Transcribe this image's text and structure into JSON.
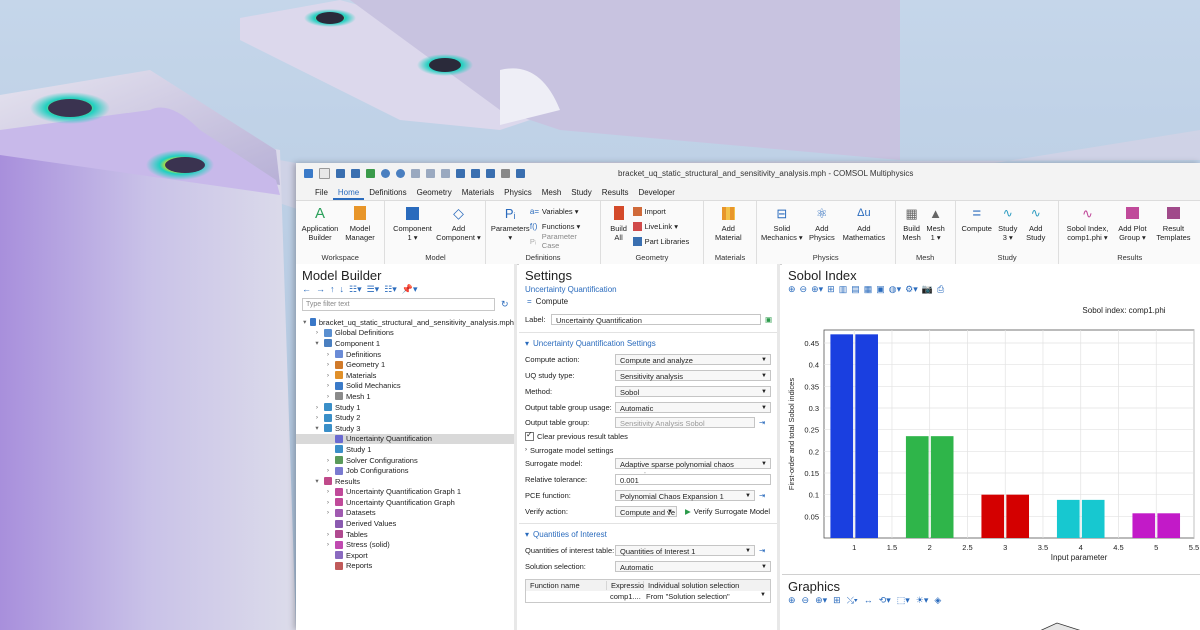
{
  "window": {
    "title": "bracket_uq_static_structural_and_sensitivity_analysis.mph - COMSOL Multiphysics"
  },
  "menu": [
    "File",
    "Home",
    "Definitions",
    "Geometry",
    "Materials",
    "Physics",
    "Mesh",
    "Study",
    "Results",
    "Developer"
  ],
  "active_menu": "Home",
  "ribbon": {
    "workspace": {
      "label": "Workspace",
      "buttons": [
        {
          "l1": "Application",
          "l2": "Builder"
        },
        {
          "l1": "Model",
          "l2": "Manager"
        }
      ]
    },
    "model": {
      "label": "Model",
      "buttons": [
        {
          "l1": "Component",
          "l2": "1 ▾"
        },
        {
          "l1": "Add",
          "l2": "Component ▾"
        }
      ]
    },
    "definitions": {
      "label": "Definitions",
      "parameters": {
        "l1": "Parameters",
        "l2": "▾"
      },
      "small": [
        "Variables ▾",
        "Functions ▾",
        "Parameter Case"
      ]
    },
    "geometry": {
      "label": "Geometry",
      "build": {
        "l1": "Build",
        "l2": "All"
      },
      "small": [
        "Import",
        "LiveLink ▾",
        "Part Libraries"
      ]
    },
    "materials": {
      "label": "Materials",
      "buttons": [
        {
          "l1": "Add",
          "l2": "Material"
        }
      ]
    },
    "physics": {
      "label": "Physics",
      "buttons": [
        {
          "l1": "Solid",
          "l2": "Mechanics ▾"
        },
        {
          "l1": "Add",
          "l2": "Physics"
        },
        {
          "l1": "Add",
          "l2": "Mathematics"
        }
      ]
    },
    "mesh": {
      "label": "Mesh",
      "buttons": [
        {
          "l1": "Build",
          "l2": "Mesh"
        },
        {
          "l1": "Mesh",
          "l2": "1 ▾"
        }
      ]
    },
    "study": {
      "label": "Study",
      "buttons": [
        {
          "l1": "Compute",
          "l2": ""
        },
        {
          "l1": "Study",
          "l2": "3 ▾"
        },
        {
          "l1": "Add",
          "l2": "Study"
        }
      ]
    },
    "results": {
      "label": "Results",
      "buttons": [
        {
          "l1": "Sobol Index,",
          "l2": "comp1.phi ▾"
        },
        {
          "l1": "Add Plot",
          "l2": "Group ▾"
        },
        {
          "l1": "Result",
          "l2": "Templates"
        }
      ]
    }
  },
  "model_builder": {
    "title": "Model Builder",
    "filter_placeholder": "Type filter text",
    "tree": [
      {
        "label": "bracket_uq_static_structural_and_sensitivity_analysis.mph",
        "level": 0,
        "exp": "▾",
        "color": "#3a78c8"
      },
      {
        "label": "Global Definitions",
        "level": 1,
        "exp": "›",
        "color": "#5a8fd0"
      },
      {
        "label": "Component 1",
        "level": 1,
        "exp": "▾",
        "color": "#4a7fc0"
      },
      {
        "label": "Definitions",
        "level": 2,
        "exp": "›",
        "color": "#6a8bd6"
      },
      {
        "label": "Geometry 1",
        "level": 2,
        "exp": "›",
        "color": "#d07a2a"
      },
      {
        "label": "Materials",
        "level": 2,
        "exp": "›",
        "color": "#e0902a"
      },
      {
        "label": "Solid Mechanics",
        "level": 2,
        "exp": "›",
        "color": "#3a7ac8"
      },
      {
        "label": "Mesh 1",
        "level": 2,
        "exp": "›",
        "color": "#8a8a8a"
      },
      {
        "label": "Study 1",
        "level": 1,
        "exp": "›",
        "color": "#3a8fc8"
      },
      {
        "label": "Study 2",
        "level": 1,
        "exp": "›",
        "color": "#3a8fc8"
      },
      {
        "label": "Study 3",
        "level": 1,
        "exp": "▾",
        "color": "#3a8fc8"
      },
      {
        "label": "Uncertainty Quantification",
        "level": 2,
        "exp": "",
        "color": "#6a6ad0",
        "selected": true
      },
      {
        "label": "Study 1",
        "level": 2,
        "exp": "",
        "color": "#3a8fc8"
      },
      {
        "label": "Solver Configurations",
        "level": 2,
        "exp": "›",
        "color": "#5a9a5a"
      },
      {
        "label": "Job Configurations",
        "level": 2,
        "exp": "›",
        "color": "#7a7ad0"
      },
      {
        "label": "Results",
        "level": 1,
        "exp": "▾",
        "color": "#c04a8a"
      },
      {
        "label": "Uncertainty Quantification Graph 1",
        "level": 2,
        "exp": "›",
        "color": "#c04a9a"
      },
      {
        "label": "Uncertainty Quantification Graph",
        "level": 2,
        "exp": "›",
        "color": "#c04a9a"
      },
      {
        "label": "Datasets",
        "level": 2,
        "exp": "›",
        "color": "#a05ab0"
      },
      {
        "label": "Derived Values",
        "level": 2,
        "exp": "",
        "color": "#8a5ab0"
      },
      {
        "label": "Tables",
        "level": 2,
        "exp": "›",
        "color": "#b04a90"
      },
      {
        "label": "Stress (solid)",
        "level": 2,
        "exp": "›",
        "color": "#c04ab0"
      },
      {
        "label": "Export",
        "level": 2,
        "exp": "",
        "color": "#8a6ac0"
      },
      {
        "label": "Reports",
        "level": 2,
        "exp": "",
        "color": "#c05a5a"
      }
    ]
  },
  "settings": {
    "title": "Settings",
    "subtitle": "Uncertainty Quantification",
    "compute": "Compute",
    "label_caption": "Label:",
    "label_value": "Uncertainty Quantification",
    "section1": "Uncertainty Quantification Settings",
    "fields": [
      {
        "label": "Compute action:",
        "value": "Compute and analyze",
        "type": "dd"
      },
      {
        "label": "UQ study type:",
        "value": "Sensitivity analysis",
        "type": "dd"
      },
      {
        "label": "Method:",
        "value": "Sobol",
        "type": "dd"
      },
      {
        "label": "Output table group usage:",
        "value": "Automatic",
        "type": "dd"
      },
      {
        "label": "Output table group:",
        "value": "Sensitivity Analysis Sobol",
        "type": "dis"
      }
    ],
    "check_clear": "Clear previous result tables",
    "surrogate_settings": "Surrogate model settings",
    "fields2": [
      {
        "label": "Surrogate model:",
        "value": "Adaptive sparse polynomial chaos expansion",
        "type": "dd"
      },
      {
        "label": "Relative tolerance:",
        "value": "0.001",
        "type": "txt"
      },
      {
        "label": "PCE function:",
        "value": "Polynomial Chaos Expansion 1",
        "type": "dd"
      },
      {
        "label": "Verify action:",
        "value": "Compute and ve",
        "type": "dd"
      }
    ],
    "verify_button": "Verify Surrogate Model",
    "section2": "Quantities of Interest",
    "qoi_table_label": "Quantities of interest table:",
    "qoi_table_value": "Quantities of Interest 1",
    "solution_selection_label": "Solution selection:",
    "solution_selection_value": "Automatic",
    "table_headers": [
      "Function name",
      "Expressio",
      "Individual solution selection"
    ],
    "table_row": [
      "",
      "comp1....",
      "From \"Solution selection\""
    ]
  },
  "sobol": {
    "title": "Sobol Index",
    "graphics_title": "Graphics"
  },
  "chart_data": {
    "type": "bar",
    "title": "Sobol index: comp1.phi",
    "xlabel": "Input parameter",
    "ylabel": "First-order and total Sobol indices",
    "x_ticks": [
      "1",
      "1.5",
      "2",
      "2.5",
      "3",
      "3.5",
      "4",
      "4.5",
      "5",
      "5.5"
    ],
    "y_ticks": [
      "0.05",
      "0.1",
      "0.15",
      "0.2",
      "0.25",
      "0.3",
      "0.35",
      "0.4",
      "0.45"
    ],
    "xlim": [
      0.6,
      5.5
    ],
    "ylim": [
      0,
      0.48
    ],
    "grid": true,
    "series": [
      {
        "values": [
          0.47,
          0.235,
          0.1,
          0.088,
          0.057
        ]
      },
      {
        "values": [
          0.47,
          0.235,
          0.1,
          0.088,
          0.057
        ]
      }
    ],
    "categories": [
      1,
      2,
      3,
      4,
      5
    ],
    "colors": [
      "#1a3fe0",
      "#2fb54a",
      "#d40000",
      "#17c8d0",
      "#c21ac8"
    ]
  }
}
